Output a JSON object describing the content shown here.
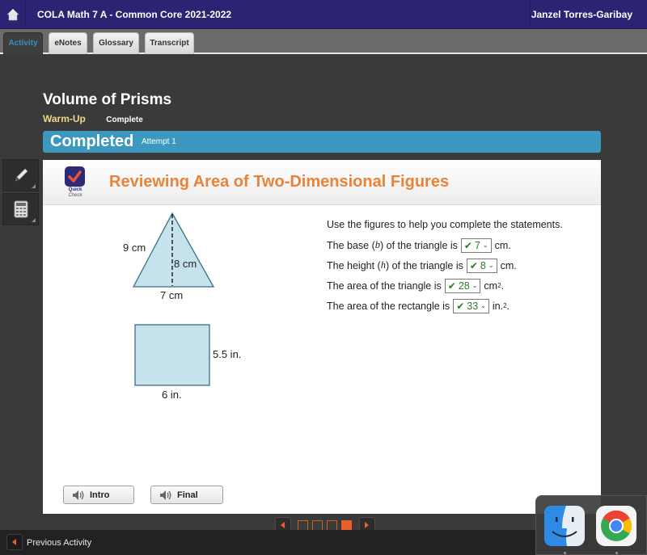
{
  "header": {
    "home_icon": "home-icon",
    "course_title": "COLA Math 7 A - Common Core 2021-2022",
    "user_name": "Janzel Torres-Garibay"
  },
  "tabs": [
    {
      "label": "Activity",
      "active": true
    },
    {
      "label": "eNotes",
      "active": false
    },
    {
      "label": "Glossary",
      "active": false
    },
    {
      "label": "Transcript",
      "active": false
    }
  ],
  "lesson": {
    "title": "Volume of Prisms",
    "section": "Warm-Up",
    "status": "Complete"
  },
  "completion": {
    "label": "Completed",
    "attempt": "Attempt 1"
  },
  "tools": [
    {
      "name": "pencil-icon"
    },
    {
      "name": "calculator-icon"
    }
  ],
  "activity": {
    "badge_line1": "Quick",
    "badge_line2": "Check",
    "title": "Reviewing Area of Two-Dimensional Figures",
    "instructions": "Use the figures to help you complete the statements.",
    "statements": [
      {
        "before": "The base (",
        "var": "b",
        "mid": ") of the triangle is",
        "answer": "7",
        "unit": "cm.",
        "sup": "",
        "after": ""
      },
      {
        "before": "The height (",
        "var": "h",
        "mid": ") of the triangle is",
        "answer": "8",
        "unit": "cm.",
        "sup": "",
        "after": ""
      },
      {
        "before": "The area of the triangle is",
        "var": "",
        "mid": "",
        "answer": "28",
        "unit": "cm",
        "sup": "2",
        "after": "."
      },
      {
        "before": "The area of the rectangle is",
        "var": "",
        "mid": "",
        "answer": "33",
        "unit": "in.",
        "sup": "2",
        "after": "."
      }
    ],
    "correct_mark": "✔",
    "figures": {
      "triangle": {
        "side_label": "9 cm",
        "height_label": "8 cm",
        "base_label": "7 cm"
      },
      "rectangle": {
        "height_label": "5.5 in.",
        "width_label": "6 in."
      },
      "fill_color": "#c6e2ec",
      "stroke_color": "#3a6f80"
    }
  },
  "audio_buttons": [
    {
      "label": "Intro"
    },
    {
      "label": "Final"
    }
  ],
  "pager": {
    "pages": 4,
    "current": 4
  },
  "footer": {
    "previous_label": "Previous Activity"
  },
  "dock": {
    "apps": [
      "Finder",
      "Google Chrome"
    ]
  },
  "colors": {
    "header_bg": "#2c2472",
    "accent_blue": "#3d98bf",
    "title_orange": "#e8833a",
    "warm_up": "#f0d88a",
    "correct_green": "#2a7a2a",
    "pager_orange": "#e8602a"
  }
}
